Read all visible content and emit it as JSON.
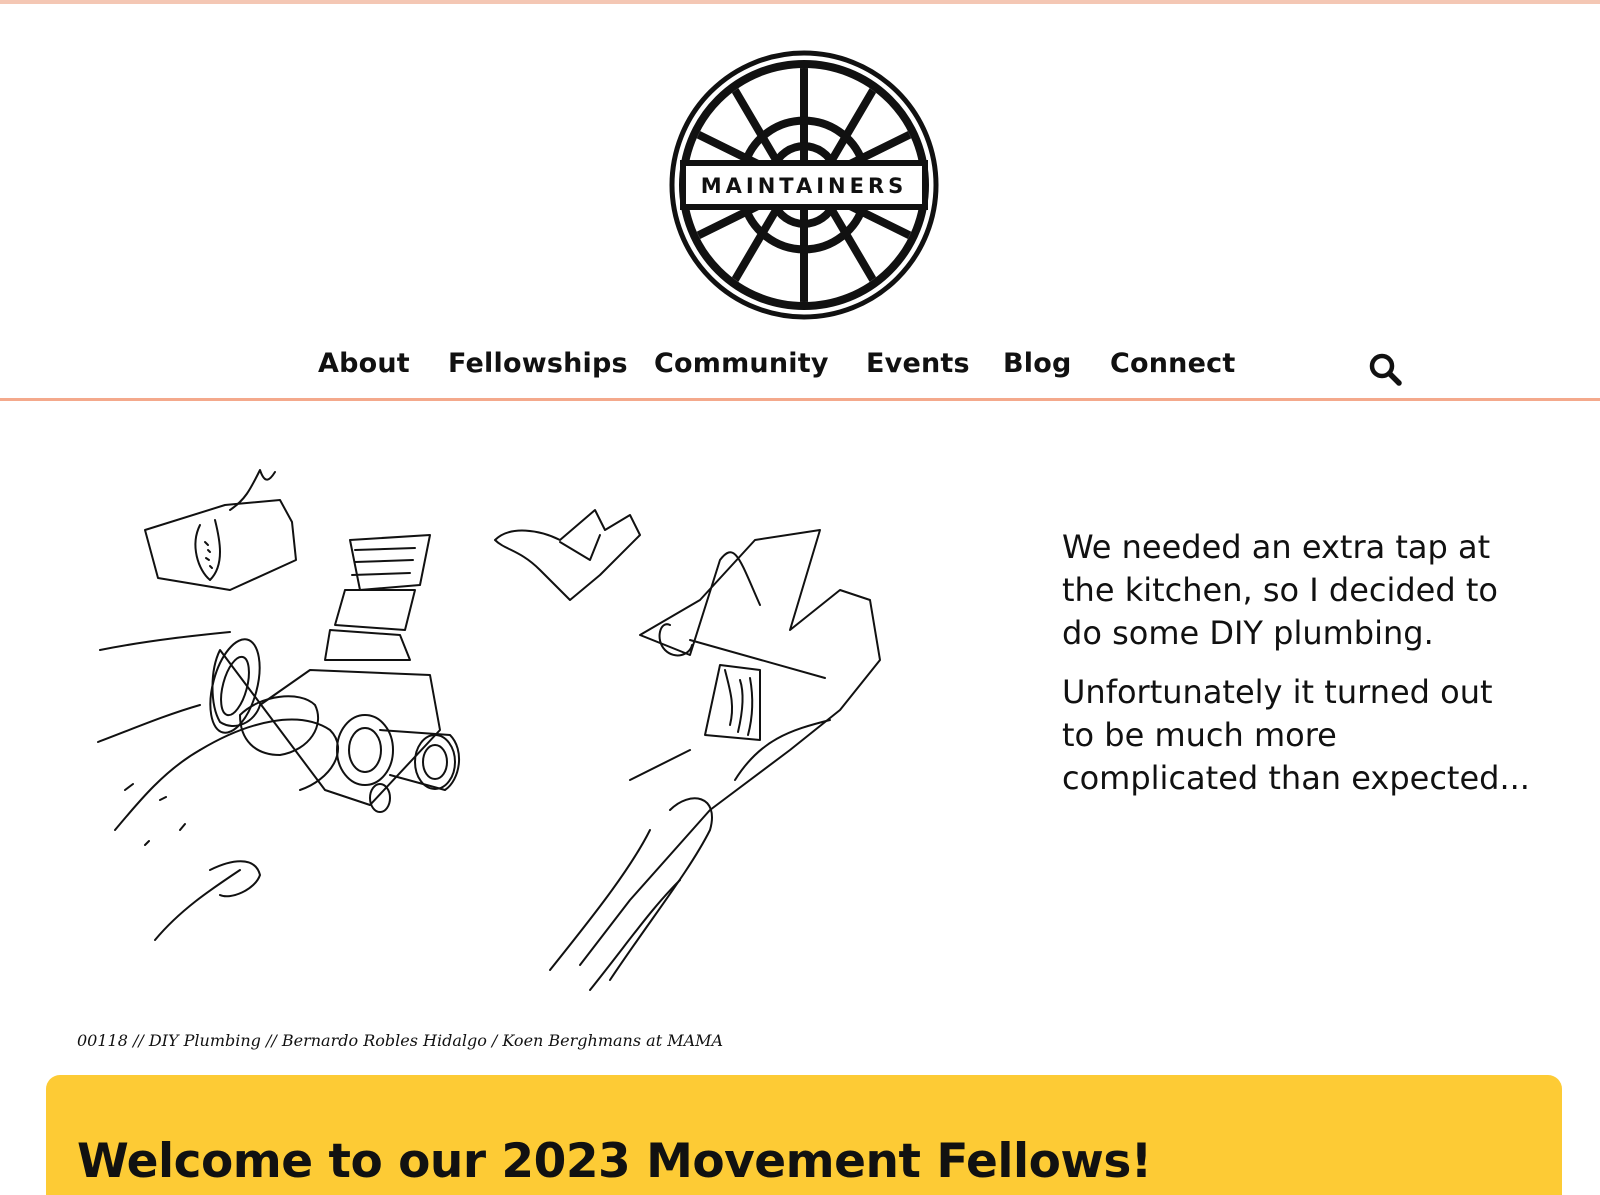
{
  "site": {
    "logo_text": "MAINTAINERS"
  },
  "nav": {
    "items": [
      {
        "label": "About"
      },
      {
        "label": "Fellowships"
      },
      {
        "label": "Community"
      },
      {
        "label": "Events"
      },
      {
        "label": "Blog"
      },
      {
        "label": "Connect"
      }
    ],
    "search_icon": "search-icon"
  },
  "hero": {
    "paragraphs": [
      "We needed an extra tap at the kitchen, so I decided to do some DIY plumbing.",
      "Unfortunately it turned out to be much more complicated than expected..."
    ],
    "caption": "00118 // DIY Plumbing // Bernardo Robles Hidalgo / Koen Berghmans at MAMA"
  },
  "banner": {
    "title": "Welcome to our 2023 Movement Fellows!",
    "color": "#fdcb35"
  },
  "colors": {
    "accent_line": "#f4a98c",
    "text": "#111111"
  }
}
